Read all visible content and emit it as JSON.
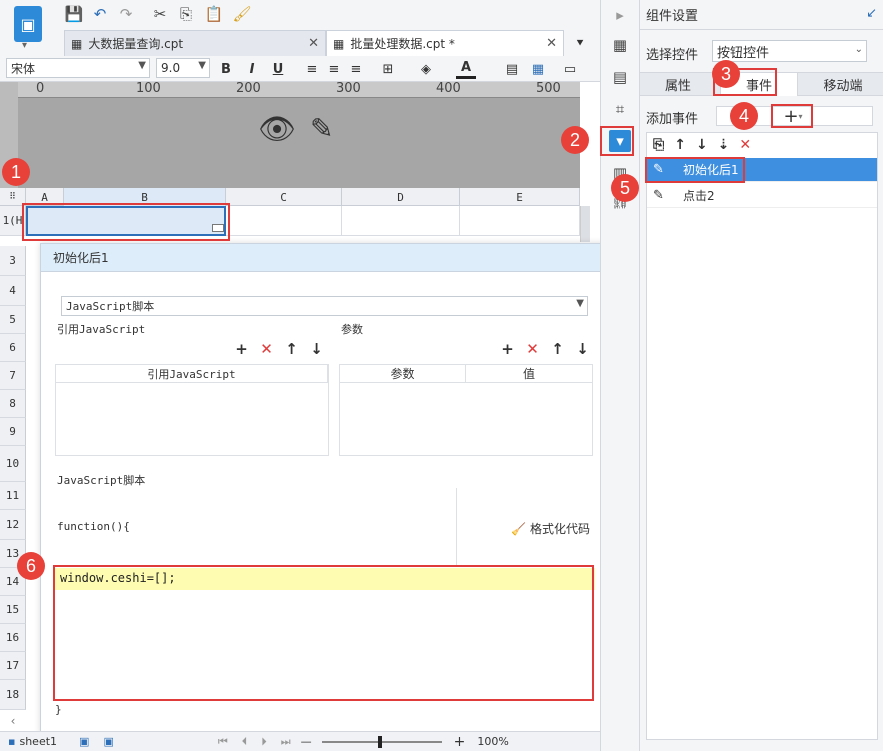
{
  "toolbar": {
    "logo_glyph": "▣"
  },
  "tabs": [
    {
      "label": "大数据量查询.cpt"
    },
    {
      "label": "批量处理数据.cpt *"
    }
  ],
  "font": {
    "family": "宋体",
    "size": "9.0"
  },
  "ruler": {
    "ticks": [
      "0",
      "100",
      "200",
      "300",
      "400",
      "500"
    ]
  },
  "grid": {
    "columns": [
      "A",
      "B",
      "C",
      "D",
      "E"
    ],
    "rows": [
      "1(H",
      "3",
      "4",
      "5",
      "6",
      "7",
      "8",
      "9",
      "10",
      "11",
      "12",
      "13",
      "14",
      "15",
      "16",
      "17",
      "18"
    ]
  },
  "badges": [
    "1",
    "2",
    "3",
    "4",
    "5",
    "6"
  ],
  "dialog": {
    "title": "初始化后1",
    "type_select": "JavaScript脚本",
    "ref_label": "引用JavaScript",
    "param_label": "参数",
    "ref_col": "引用JavaScript",
    "param_col": "参数",
    "value_col": "值",
    "script_label": "JavaScript脚本",
    "func_header": "function(){",
    "format_label": "格式化代码",
    "code": "window.ceshi=[];",
    "func_footer": "}"
  },
  "right_panel": {
    "title": "组件设置",
    "select_label": "选择控件",
    "select_value": "按钮控件",
    "tabs": [
      "属性",
      "事件",
      "移动端"
    ],
    "add_event_label": "添加事件",
    "events": [
      {
        "label": "初始化后1",
        "selected": true
      },
      {
        "label": "点击2",
        "selected": false
      }
    ]
  },
  "status": {
    "sheet": "sheet1",
    "zoom": "100%"
  }
}
